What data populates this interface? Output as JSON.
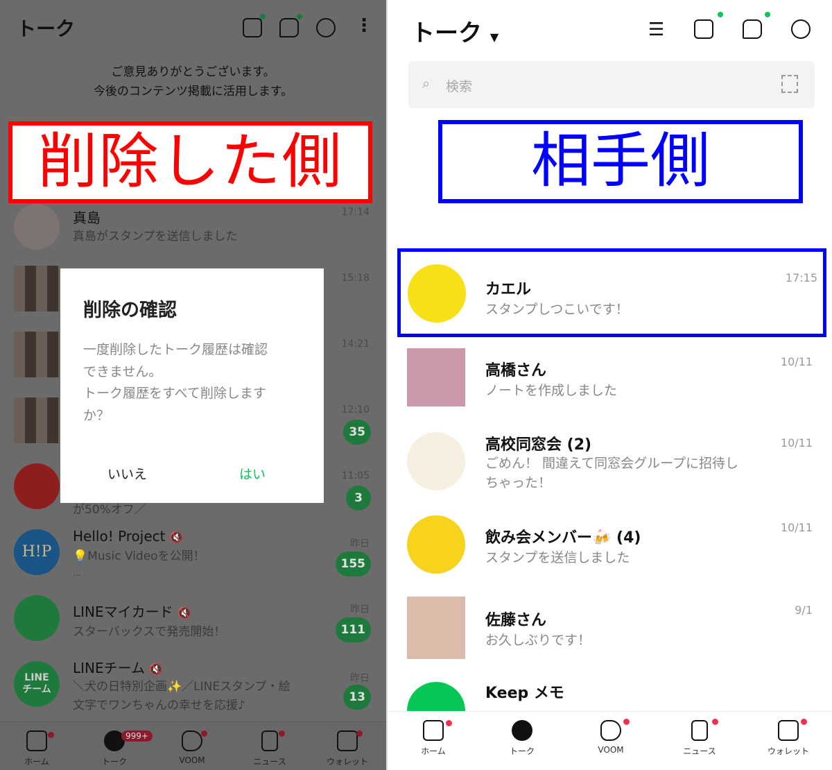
{
  "left": {
    "header_title": "トーク",
    "feedback_lines": [
      "ご意見ありがとうございます。",
      "今後のコンテンツ掲載に活用します。"
    ],
    "label": "削除した側",
    "label_color": "#ff0000",
    "chats": [
      {
        "name": "真島",
        "message": "真島がスタンプを送信しました",
        "time": "17:14"
      },
      {
        "name": "",
        "message": "",
        "time": "15:18"
      },
      {
        "name": "",
        "message": "",
        "time": "14:21"
      },
      {
        "name": "",
        "message": "",
        "time": "12:10",
        "badge": "35"
      },
      {
        "name": "",
        "message": "が50%オフ／",
        "time": "11:05",
        "badge": "3"
      },
      {
        "name": "Hello! Project",
        "message": "💡Music Videoを公開！",
        "message2": "...",
        "time": "昨日",
        "badge": "155",
        "avatar_text": "H!P",
        "muted": true
      },
      {
        "name": "LINEマイカード",
        "message": "スターバックスで発売開始！",
        "time": "昨日",
        "badge": "111",
        "muted": true
      },
      {
        "name": "LINEチーム",
        "message": "＼犬の日特別企画✨／LINEスタンプ・絵",
        "message2": "文字でワンちゃんの幸せを応援♪",
        "time": "昨日",
        "badge": "13",
        "avatar_text": "LINE\nチーム",
        "muted": true
      }
    ],
    "dialog": {
      "title": "削除の確認",
      "body": [
        "一度削除したトーク履歴は確認",
        "できません。",
        "トーク履歴をすべて削除します",
        "か？"
      ],
      "cancel": "いいえ",
      "confirm": "はい"
    },
    "nav": [
      {
        "label": "ホーム",
        "icon": "home-icon"
      },
      {
        "label": "トーク",
        "icon": "chat-icon",
        "badge": "999+"
      },
      {
        "label": "VOOM",
        "icon": "voom-icon"
      },
      {
        "label": "ニュース",
        "icon": "news-icon"
      },
      {
        "label": "ウォレット",
        "icon": "wallet-icon"
      }
    ]
  },
  "right": {
    "header_title": "トーク",
    "search_placeholder": "検索",
    "label": "相手側",
    "label_color": "#0000ff",
    "chats": [
      {
        "name": "カエル",
        "message": "スタンプしつこいです！",
        "time": "17:15"
      },
      {
        "name": "高橋さん",
        "message": "ノートを作成しました",
        "time": "10/11"
      },
      {
        "name": "高校同窓会 (2)",
        "message": "ごめん！ 間違えて同窓会グループに招待し",
        "message2": "ちゃった！",
        "time": "10/11"
      },
      {
        "name": "飲み会メンバー🍻 (4)",
        "message": "スタンプを送信しました",
        "time": "10/11"
      },
      {
        "name": "佐藤さん",
        "message": "お久しぶりです！",
        "time": "9/1"
      },
      {
        "name": "Keep メモ",
        "message": "",
        "time": ""
      }
    ],
    "nav": [
      {
        "label": "ホーム",
        "icon": "home-icon"
      },
      {
        "label": "トーク",
        "icon": "chat-icon"
      },
      {
        "label": "VOOM",
        "icon": "voom-icon"
      },
      {
        "label": "ニュース",
        "icon": "news-icon"
      },
      {
        "label": "ウォレット",
        "icon": "wallet-icon"
      }
    ]
  },
  "colors": {
    "line_green": "#06c755",
    "badge_red": "#e0284a"
  }
}
